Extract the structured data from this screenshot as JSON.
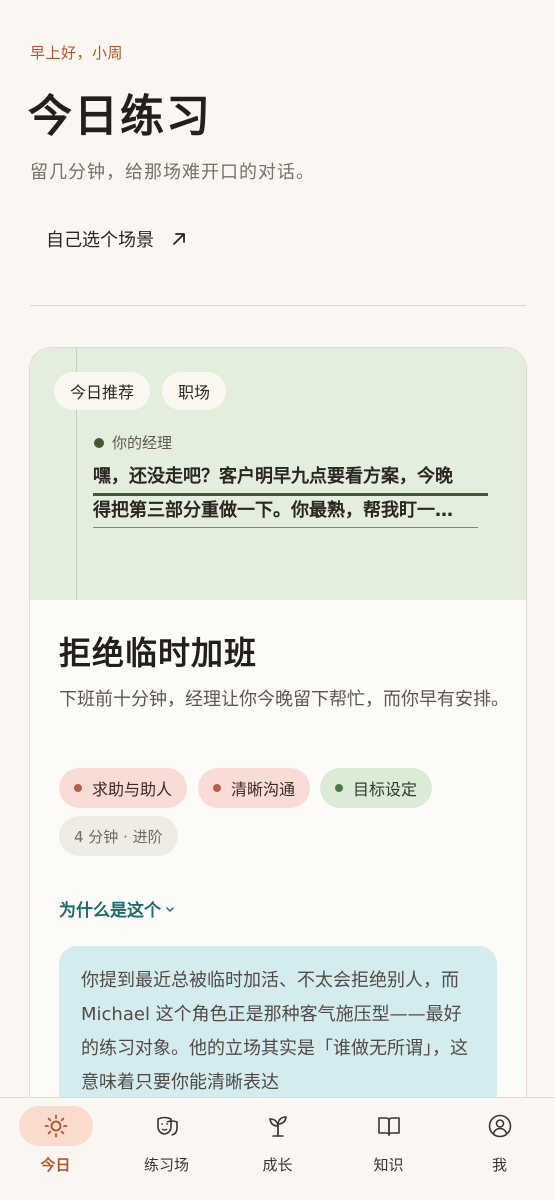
{
  "header": {
    "greeting": "早上好，小周",
    "title": "今日练习",
    "subtitle": "留几分钟，给那场难开口的对话。",
    "custom_scene_label": "自己选个场景"
  },
  "card": {
    "chips": [
      "今日推荐",
      "职场"
    ],
    "speaker": "你的经理",
    "quote_line1": "嘿，还没走吧？客户明早九点要看方案，今晚",
    "quote_line2": "得把第三部分重做一下。你最熟，帮我盯一…",
    "title": "拒绝临时加班",
    "description": "下班前十分钟，经理让你今晚留下帮忙，而你早有安排。",
    "tags": [
      {
        "label": "求助与助人",
        "tone": "red"
      },
      {
        "label": "清晰沟通",
        "tone": "red"
      },
      {
        "label": "目标设定",
        "tone": "green"
      }
    ],
    "meta": "4 分钟 · 进阶",
    "why_label": "为什么是这个",
    "why_text": "你提到最近总被临时加活、不太会拒绝别人，而 Michael 这个角色正是那种客气施压型——最好的练习对象。他的立场其实是「谁做无所谓」，这意味着只要你能清晰表达"
  },
  "tabbar": {
    "tabs": [
      {
        "label": "今日",
        "icon": "sun-icon",
        "active": true
      },
      {
        "label": "练习场",
        "icon": "theater-masks-icon",
        "active": false
      },
      {
        "label": "成长",
        "icon": "sprout-icon",
        "active": false
      },
      {
        "label": "知识",
        "icon": "open-book-icon",
        "active": false
      },
      {
        "label": "我",
        "icon": "user-circle-icon",
        "active": false
      }
    ]
  },
  "colors": {
    "accent": "#b5542c",
    "background": "#faf6f1",
    "card_top": "#e4eedc",
    "why_box": "#d4ecef",
    "link": "#1e6a6e"
  }
}
